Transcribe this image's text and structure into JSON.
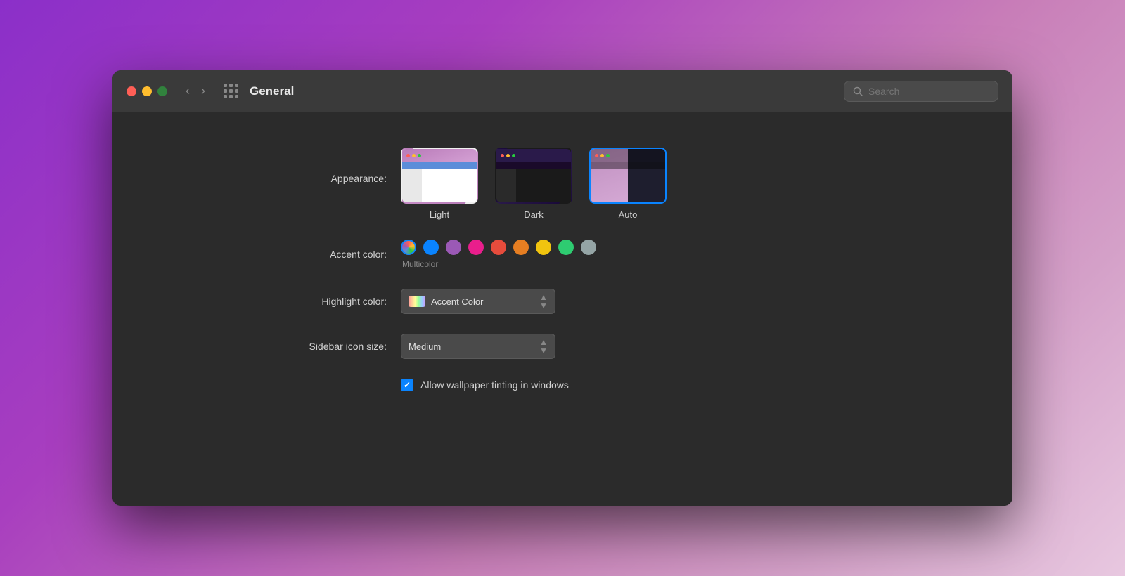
{
  "window": {
    "title": "General"
  },
  "titlebar": {
    "back_label": "‹",
    "forward_label": "›",
    "search_placeholder": "Search"
  },
  "appearance": {
    "label": "Appearance:",
    "options": [
      {
        "id": "light",
        "name": "Light",
        "selected": false
      },
      {
        "id": "dark",
        "name": "Dark",
        "selected": false
      },
      {
        "id": "auto",
        "name": "Auto",
        "selected": true
      }
    ]
  },
  "accent_color": {
    "label": "Accent color:",
    "selected": "multicolor",
    "color_name": "Multicolor",
    "colors": [
      {
        "id": "multicolor",
        "name": "Multicolor",
        "value": "multicolor"
      },
      {
        "id": "blue",
        "name": "Blue",
        "value": "#0A84FF"
      },
      {
        "id": "purple",
        "name": "Purple",
        "value": "#9B59B6"
      },
      {
        "id": "pink",
        "name": "Pink",
        "value": "#E91E8C"
      },
      {
        "id": "red",
        "name": "Red",
        "value": "#E74C3C"
      },
      {
        "id": "orange",
        "name": "Orange",
        "value": "#E67E22"
      },
      {
        "id": "yellow",
        "name": "Yellow",
        "value": "#F1C40F"
      },
      {
        "id": "green",
        "name": "Green",
        "value": "#2ECC71"
      },
      {
        "id": "graphite",
        "name": "Graphite",
        "value": "#95A5A6"
      }
    ]
  },
  "highlight_color": {
    "label": "Highlight color:",
    "value": "Accent Color"
  },
  "sidebar_icon_size": {
    "label": "Sidebar icon size:",
    "value": "Medium"
  },
  "wallpaper_tinting": {
    "label": "Allow wallpaper tinting in windows",
    "checked": true
  }
}
